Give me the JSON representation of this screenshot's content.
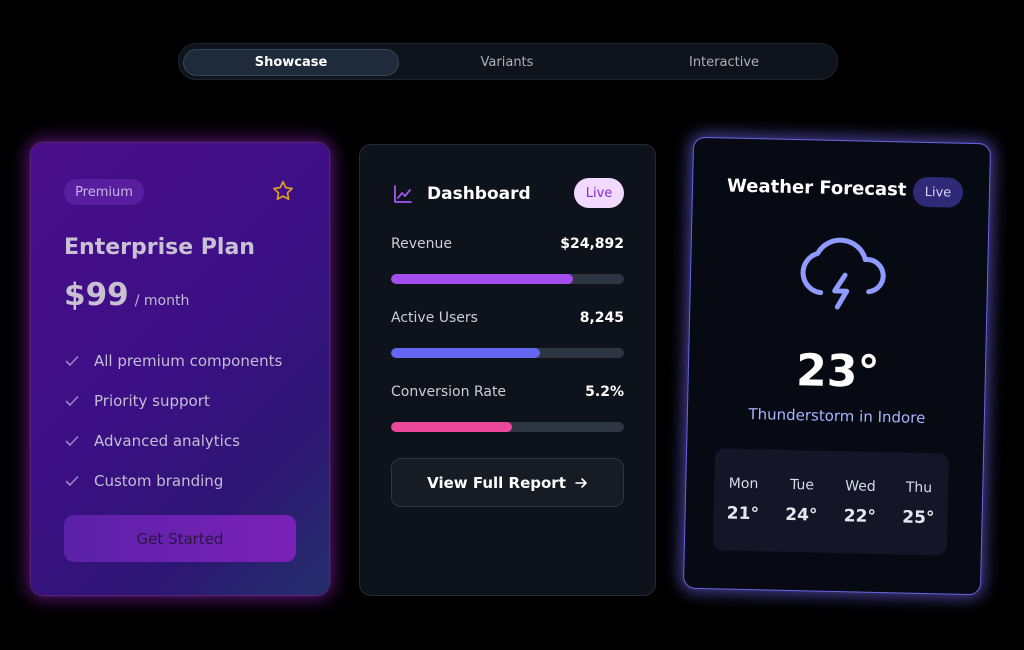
{
  "tabs": [
    {
      "label": "Showcase",
      "active": true
    },
    {
      "label": "Variants",
      "active": false
    },
    {
      "label": "Interactive",
      "active": false
    }
  ],
  "pricing_card": {
    "badge": "Premium",
    "title": "Enterprise Plan",
    "price": "$99",
    "period": "/ month",
    "features": [
      "All premium components",
      "Priority support",
      "Advanced analytics",
      "Custom branding"
    ],
    "cta_label": "Get Started",
    "icons": {
      "favorite": "star-icon",
      "feature": "check-icon"
    }
  },
  "dashboard_card": {
    "title": "Dashboard",
    "badge": "Live",
    "metrics": [
      {
        "label": "Revenue",
        "value": "$24,892",
        "progress": 0.78,
        "color": "#a64df0"
      },
      {
        "label": "Active Users",
        "value": "8,245",
        "progress": 0.64,
        "color": "#6366f1"
      },
      {
        "label": "Conversion Rate",
        "value": "5.2%",
        "progress": 0.52,
        "color": "#ec4899"
      }
    ],
    "button_label": "View Full Report",
    "icons": {
      "header": "line-chart-icon",
      "button": "arrow-right-icon"
    }
  },
  "weather_card": {
    "title": "Weather Forecast",
    "badge": "Live",
    "temperature": "23°",
    "description": "Thunderstorm in Indore",
    "icon": "thunderstorm-cloud-icon",
    "forecast": [
      {
        "day": "Mon",
        "temp": "21°"
      },
      {
        "day": "Tue",
        "temp": "24°"
      },
      {
        "day": "Wed",
        "temp": "22°"
      },
      {
        "day": "Thu",
        "temp": "25°"
      }
    ]
  }
}
